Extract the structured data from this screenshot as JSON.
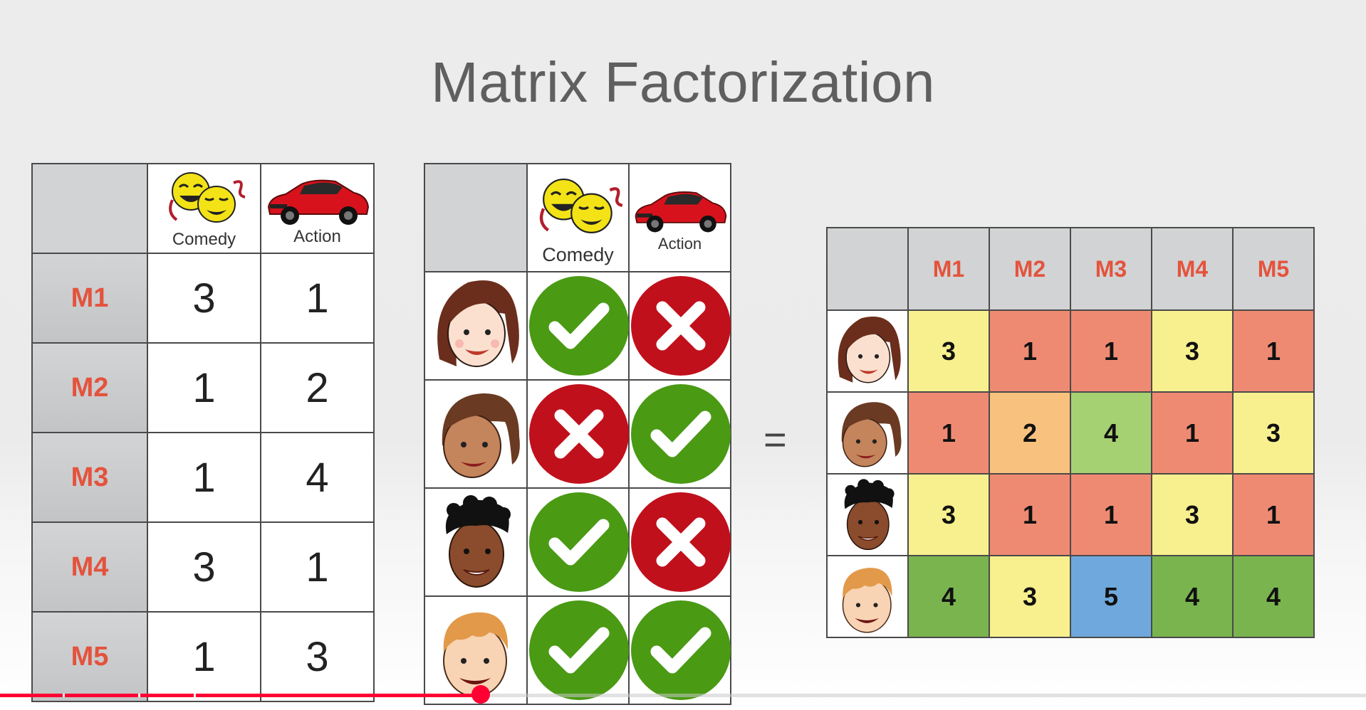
{
  "slide": {
    "title": "Matrix Factorization"
  },
  "movie_genre_table": {
    "headers": [
      {
        "label": "Comedy",
        "icon": "comedy-masks-icon"
      },
      {
        "label": "Action",
        "icon": "red-sports-car-icon"
      }
    ],
    "rows": [
      {
        "movie": "M1",
        "comedy": "3",
        "action": "1"
      },
      {
        "movie": "M2",
        "comedy": "1",
        "action": "2"
      },
      {
        "movie": "M3",
        "comedy": "1",
        "action": "4"
      },
      {
        "movie": "M4",
        "comedy": "3",
        "action": "1"
      },
      {
        "movie": "M5",
        "comedy": "1",
        "action": "3"
      }
    ]
  },
  "user_preference_table": {
    "headers": [
      {
        "label": "Comedy",
        "icon": "comedy-masks-icon"
      },
      {
        "label": "Action",
        "icon": "red-sports-car-icon"
      }
    ],
    "rows": [
      {
        "face": "user-face-1-icon",
        "comedy": "check",
        "action": "cross"
      },
      {
        "face": "user-face-2-icon",
        "comedy": "cross",
        "action": "check"
      },
      {
        "face": "user-face-3-icon",
        "comedy": "check",
        "action": "cross"
      },
      {
        "face": "user-face-4-icon",
        "comedy": "check",
        "action": "check"
      }
    ],
    "colors": {
      "check": "#4a9a14",
      "cross": "#c0101c"
    }
  },
  "operator": "=",
  "rating_matrix": {
    "columns": [
      "M1",
      "M2",
      "M3",
      "M4",
      "M5"
    ],
    "rows": [
      {
        "face": "user-face-1-icon",
        "values": [
          "3",
          "1",
          "1",
          "3",
          "1"
        ]
      },
      {
        "face": "user-face-2-icon",
        "values": [
          "1",
          "2",
          "4",
          "1",
          "3"
        ]
      },
      {
        "face": "user-face-3-icon",
        "values": [
          "3",
          "1",
          "1",
          "3",
          "1"
        ]
      },
      {
        "face": "user-face-4-icon",
        "values": [
          "4",
          "3",
          "5",
          "4",
          "4"
        ]
      }
    ],
    "value_colors": {
      "1": "#ef8a72",
      "2": "#f8c27e",
      "3": "#f8f08e",
      "4": "#9bcd6e",
      "5": "#6fa8dc"
    },
    "overrides": [
      {
        "row": 3,
        "col": 0,
        "color": "#7ab44e"
      },
      {
        "row": 3,
        "col": 3,
        "color": "#7ab44e"
      },
      {
        "row": 3,
        "col": 4,
        "color": "#7ab44e"
      },
      {
        "row": 1,
        "col": 2,
        "color": "#a6d173"
      }
    ]
  },
  "video_player": {
    "progress": 0.352,
    "colors": {
      "played": "#ff0033"
    }
  }
}
